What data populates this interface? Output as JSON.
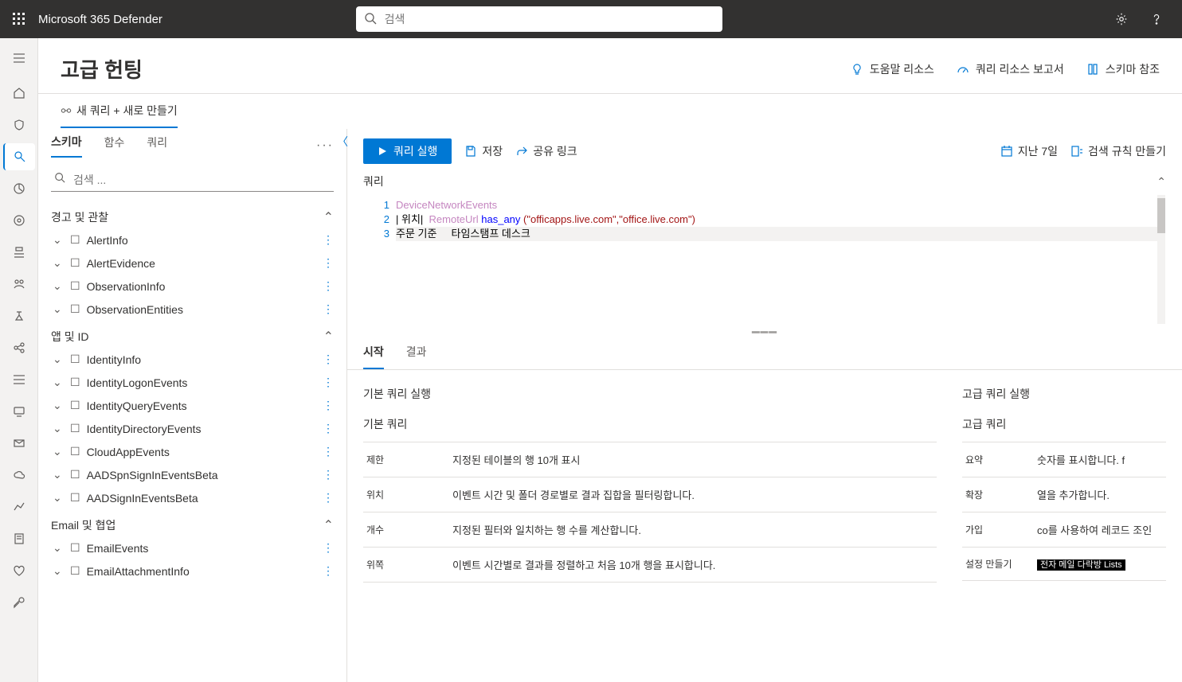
{
  "top": {
    "brand": "Microsoft 365 Defender",
    "search_placeholder": "검색"
  },
  "page": {
    "title": "고급 헌팅",
    "links": {
      "help": "도움말 리소스",
      "report": "쿼리 리소스 보고서",
      "schema_ref": "스키마 참조"
    },
    "new_query_tab": "새 쿼리 + 새로 만들기"
  },
  "panel": {
    "tabs": {
      "schema": "스키마",
      "functions": "함수",
      "queries": "쿼리"
    },
    "search_placeholder": "검색 ...",
    "groups": {
      "alerts": "경고 및 관찰",
      "apps": "앱 및 ID",
      "email": "Email 및 협업"
    },
    "items": {
      "AlertInfo": "AlertInfo",
      "AlertEvidence": "AlertEvidence",
      "ObservationInfo": "ObservationInfo",
      "ObservationEntities": "ObservationEntities",
      "IdentityInfo": "IdentityInfo",
      "IdentityLogonEvents": "IdentityLogonEvents",
      "IdentityQueryEvents": "IdentityQueryEvents",
      "IdentityDirectoryEvents": "IdentityDirectoryEvents",
      "CloudAppEvents": "CloudAppEvents",
      "AADSpnSignInEventsBeta": "AADSpnSignInEventsBeta",
      "AADSignInEventsBeta": "AADSignInEventsBeta",
      "EmailEvents": "EmailEvents",
      "EmailAttachmentInfo": "EmailAttachmentInfo"
    }
  },
  "toolbar": {
    "run": "쿼리 실행",
    "save": "저장",
    "share": "공유 링크",
    "time": "지난 7일",
    "create_rule": "검색 규칙 만들기",
    "query_label": "쿼리"
  },
  "editor": {
    "line1": {
      "a": "DeviceNetworkEvents"
    },
    "line2": {
      "a": "| 위치|  ",
      "b": "RemoteUrl",
      "c": " has_any ",
      "d": "(\"officapps.live.com\",\"office.live.com\")"
    },
    "line3": {
      "a": "주문 기준     타임스탬프 데스크"
    },
    "ln1": "1",
    "ln2": "2",
    "ln3": "3"
  },
  "results": {
    "tabs": {
      "start": "시작",
      "results": "결과"
    },
    "basic_header": "기본 쿼리 실행",
    "basic_sub": "기본 쿼리",
    "adv_header": "고급 쿼리 실행",
    "adv_sub": "고급 쿼리",
    "basic_rows": [
      {
        "k": "제한",
        "v": "지정된 테이블의 행 10개 표시"
      },
      {
        "k": "위치",
        "v": "이벤트 시간 및 폴더 경로별로 결과 집합을 필터링합니다."
      },
      {
        "k": "개수",
        "v": "지정된 필터와 일치하는 행 수를 계산합니다."
      },
      {
        "k": "위쪽",
        "v": "이벤트 시간별로 결과를 정렬하고 처음 10개 행을 표시합니다."
      }
    ],
    "adv_rows": [
      {
        "k": "요약",
        "v": "숫자를 표시합니다. f"
      },
      {
        "k": "확장",
        "v": "열을 추가합니다."
      },
      {
        "k": "가입",
        "v": "co를 사용하여 레코드 조인"
      },
      {
        "k": "설정 만들기",
        "v": "전자 메일 다락방 Lists"
      }
    ]
  }
}
